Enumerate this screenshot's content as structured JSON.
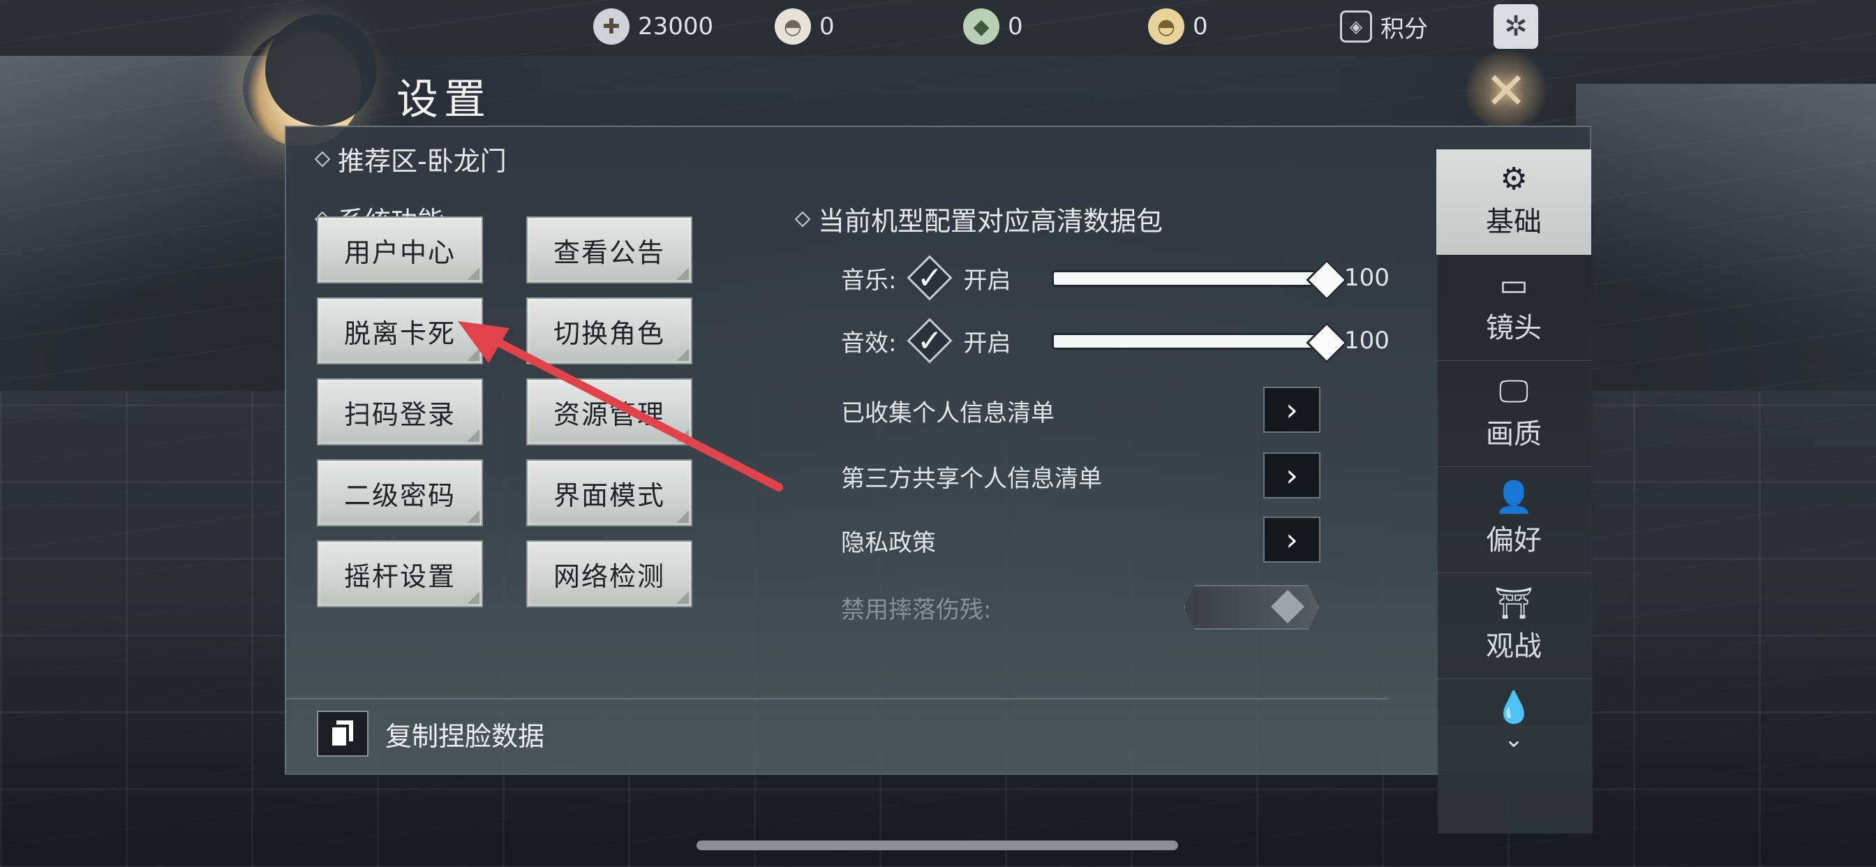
{
  "topbar": {
    "resources": [
      {
        "icon": "coin-plus-icon",
        "value": "23000"
      },
      {
        "icon": "ingot-plus-icon",
        "value": "0"
      },
      {
        "icon": "jade-plus-icon",
        "value": "0"
      },
      {
        "icon": "gold-ingot-plus-icon",
        "value": "0"
      }
    ],
    "points_label": "积分",
    "points_icon": "shield-badge-icon",
    "menu_icon": "gear-emblem-icon"
  },
  "dialog": {
    "title": "设置",
    "server": "推荐区-卧龙门",
    "system_section": "系统功能",
    "buttons": [
      "用户中心",
      "查看公告",
      "脱离卡死",
      "切换角色",
      "扫码登录",
      "资源管理",
      "二级密码",
      "界面模式",
      "摇杆设置",
      "网络检测"
    ],
    "copy_face_data": "复制捏脸数据",
    "hd_package": "当前机型配置对应高清数据包",
    "music": {
      "label": "音乐:",
      "toggle": "开启",
      "value": "100",
      "level": 1.0
    },
    "sfx": {
      "label": "音效:",
      "toggle": "开启",
      "value": "100",
      "level": 1.0
    },
    "links": [
      "已收集个人信息清单",
      "第三方共享个人信息清单",
      "隐私政策"
    ],
    "fall_damage": {
      "label": "禁用摔落伤残:",
      "enabled": false
    }
  },
  "tabs": [
    {
      "label": "基础",
      "icon": "gear-icon",
      "active": true
    },
    {
      "label": "镜头",
      "icon": "camera-icon",
      "active": false
    },
    {
      "label": "画质",
      "icon": "monitor-icon",
      "active": false
    },
    {
      "label": "偏好",
      "icon": "user-gear-icon",
      "active": false
    },
    {
      "label": "观战",
      "icon": "theater-icon",
      "active": false
    },
    {
      "label": "",
      "icon": "droplets-icon",
      "active": false
    }
  ],
  "colors": {
    "annotation": "#e0444a",
    "active_tab": "#d0d5d3"
  }
}
